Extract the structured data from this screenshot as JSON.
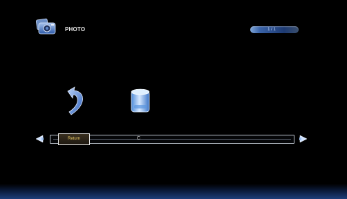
{
  "header": {
    "title": "PHOTO",
    "app_icon": "photo-camera-icon",
    "page_indicator": "1 / 1"
  },
  "items": [
    {
      "icon": "return-arrow-icon"
    },
    {
      "icon": "disk-drive-icon"
    }
  ],
  "path_bar": {
    "selected_label": "Return",
    "path_text": "C"
  },
  "colors": {
    "background": "#000000",
    "accent_blue": "#3a63a8",
    "selected_text": "#f3d36a",
    "bottom_glow": "#1d3f7a"
  }
}
